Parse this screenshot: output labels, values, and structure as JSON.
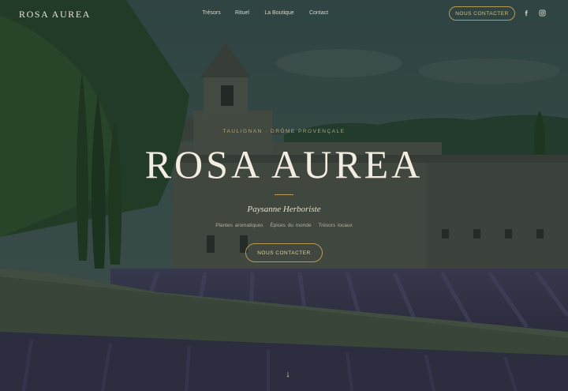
{
  "header": {
    "logo": "ROSA AUREA",
    "nav": [
      {
        "label": "Trésors"
      },
      {
        "label": "Rituel"
      },
      {
        "label": "La Boutique"
      },
      {
        "label": "Contact"
      }
    ],
    "cta": "NOUS CONTACTER",
    "social": [
      {
        "icon": "facebook-icon"
      },
      {
        "icon": "instagram-icon"
      }
    ]
  },
  "hero": {
    "location": "TAULIGNAN · DRÔME PROVENÇALE",
    "title": "ROSA AUREA",
    "tagline": "Paysanne Herboriste",
    "tags": [
      "Plantes aromatiques",
      "Épices du monde",
      "Trésors locaux"
    ],
    "cta": "NOUS CONTACTER",
    "scroll_icon": "arrow-down-icon",
    "scroll_glyph": "↓"
  },
  "colors": {
    "accent": "#b79a56",
    "text_light": "#f2ede0"
  }
}
